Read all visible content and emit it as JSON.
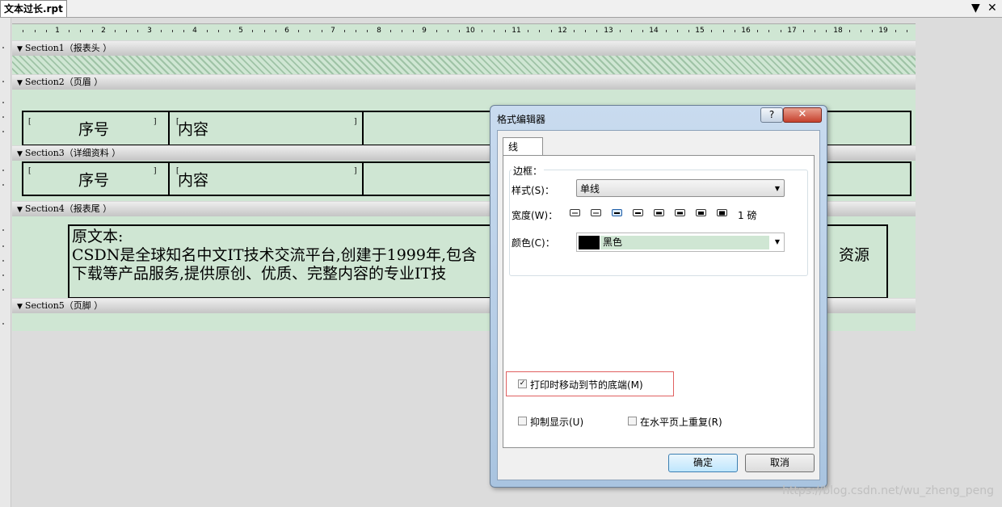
{
  "window": {
    "doc_tab": "文本过长.rpt",
    "dropdown_glyph": "▼",
    "close_glyph": "✕"
  },
  "ruler": {
    "numbers": [
      "1",
      "2",
      "3",
      "4",
      "5",
      "6",
      "7",
      "8",
      "9",
      "10",
      "11",
      "12",
      "13",
      "14",
      "15",
      "16",
      "17",
      "18",
      "19"
    ]
  },
  "sections": [
    {
      "label": "Section1（报表头 ）"
    },
    {
      "label": "Section2（页眉 ）"
    },
    {
      "label": "Section3（详细资料 ）"
    },
    {
      "label": "Section4（报表尾 ）"
    },
    {
      "label": "Section5（页脚 ）"
    }
  ],
  "fields": {
    "seq": "序号",
    "content": "内容"
  },
  "textbox": {
    "line1": "原文本:",
    "line2a": "CSDN是全球知名中文IT技术交流平台,创建于1999年,包含",
    "line2b": "资源",
    "line3": "下载等产品服务,提供原创、优质、完整内容的专业IT技"
  },
  "dialog": {
    "title": "格式编辑器",
    "help": "?",
    "close": "✕",
    "tab": "线",
    "group_label": "边框：",
    "style_label": "样式(S)：",
    "style_value": "单线",
    "width_label": "宽度(W)：",
    "width_value": "1 磅",
    "color_label": "颜色(C)：",
    "color_value": "黑色",
    "color_value_hex": "#000000",
    "move_to_bottom": {
      "label": "打印时移动到节的底端(M)",
      "checked": true
    },
    "suppress": {
      "label": "抑制显示(U)",
      "checked": false
    },
    "repeat_horizontal": {
      "label": "在水平页上重复(R)",
      "checked": false
    },
    "ok": "确定",
    "cancel": "取消"
  },
  "watermark": "https://blog.csdn.net/wu_zheng_peng"
}
